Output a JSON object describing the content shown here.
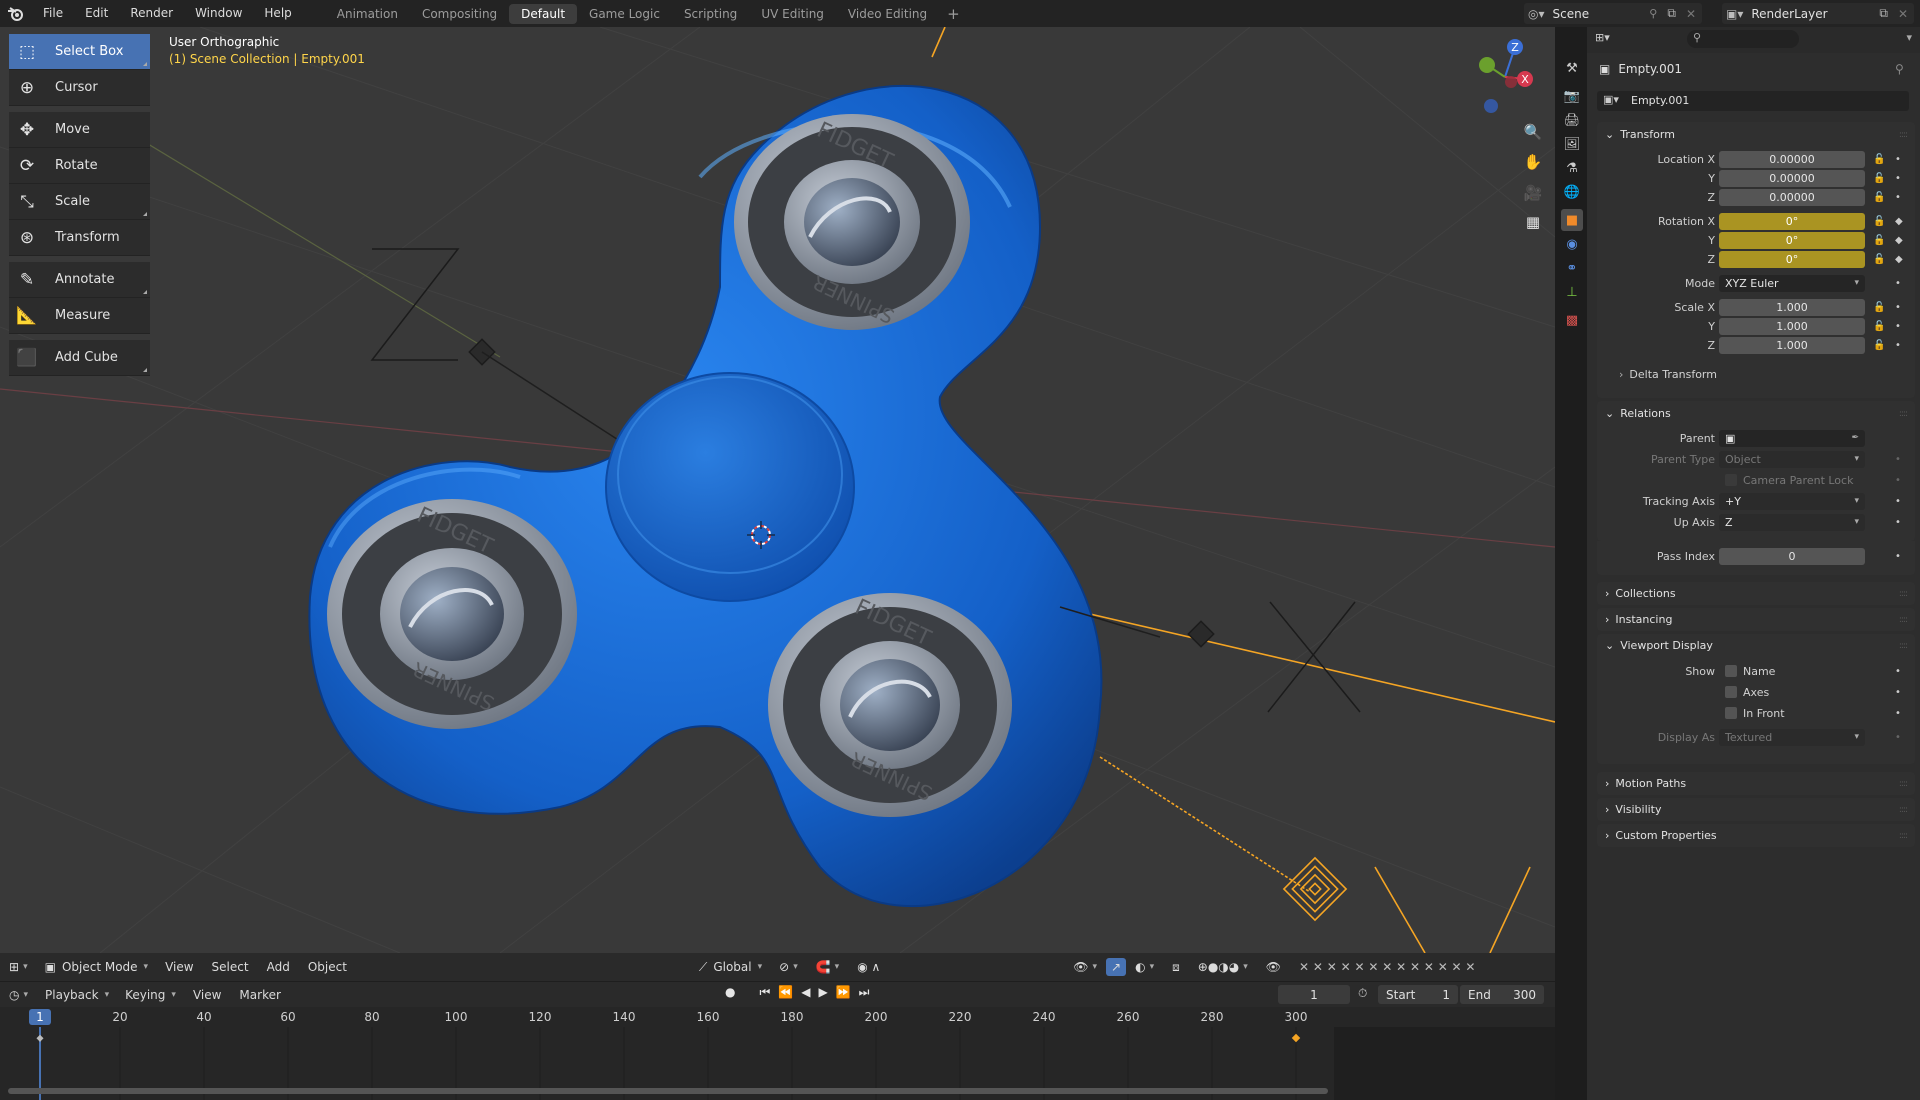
{
  "topbar": {
    "menus": [
      "File",
      "Edit",
      "Render",
      "Window",
      "Help"
    ],
    "workspaces": [
      "Animation",
      "Compositing",
      "Default",
      "Game Logic",
      "Scripting",
      "UV Editing",
      "Video Editing"
    ],
    "active_workspace": "Default",
    "scene": "Scene",
    "view_layer": "RenderLayer"
  },
  "toolbar": {
    "tools": [
      {
        "label": "Select Box",
        "icon": "select-box-icon",
        "active": true
      },
      {
        "label": "Cursor",
        "icon": "cursor-icon"
      },
      {
        "label": "Move",
        "icon": "move-icon"
      },
      {
        "label": "Rotate",
        "icon": "rotate-icon"
      },
      {
        "label": "Scale",
        "icon": "scale-icon"
      },
      {
        "label": "Transform",
        "icon": "transform-icon"
      },
      {
        "label": "Annotate",
        "icon": "annotate-icon"
      },
      {
        "label": "Measure",
        "icon": "measure-icon"
      },
      {
        "label": "Add Cube",
        "icon": "add-cube-icon"
      }
    ]
  },
  "viewport": {
    "view_name": "User Orthographic",
    "collection_path": "(1) Scene Collection | Empty.001",
    "gizmo_labels": [
      "Z",
      "X",
      "Y"
    ],
    "logo_top": "FIDGET",
    "logo_bottom": "SPINNER"
  },
  "vp_header": {
    "mode": "Object Mode",
    "menus": [
      "View",
      "Select",
      "Add",
      "Object"
    ],
    "orientation": "Global"
  },
  "timeline": {
    "menus": [
      "Playback",
      "Keying",
      "View",
      "Marker"
    ],
    "current_frame": "1",
    "start_label": "Start",
    "start": "1",
    "end_label": "End",
    "end": "300",
    "cursor_label": "1",
    "ticks": [
      "20",
      "40",
      "60",
      "80",
      "100",
      "120",
      "140",
      "160",
      "180",
      "200",
      "220",
      "240",
      "260",
      "280",
      "300"
    ]
  },
  "properties": {
    "object_name": "Empty.001",
    "data_name": "Empty.001",
    "transform": {
      "title": "Transform",
      "location_label": "Location X",
      "y_label": "Y",
      "z_label": "Z",
      "location": [
        "0.00000",
        "0.00000",
        "0.00000"
      ],
      "rotation_label": "Rotation X",
      "rotation": [
        "0°",
        "0°",
        "0°"
      ],
      "mode_label": "Mode",
      "mode": "XYZ Euler",
      "scale_label": "Scale X",
      "scale": [
        "1.000",
        "1.000",
        "1.000"
      ],
      "delta": "Delta Transform"
    },
    "relations": {
      "title": "Relations",
      "parent_label": "Parent",
      "parent_type_label": "Parent Type",
      "parent_type": "Object",
      "camera_parent_lock": "Camera Parent Lock",
      "tracking_axis_label": "Tracking Axis",
      "tracking_axis": "+Y",
      "up_axis_label": "Up Axis",
      "up_axis": "Z",
      "pass_index_label": "Pass Index",
      "pass_index": "0"
    },
    "collections": "Collections",
    "instancing": "Instancing",
    "viewport_display": {
      "title": "Viewport Display",
      "show_label": "Show",
      "name": "Name",
      "axes": "Axes",
      "in_front": "In Front",
      "display_as_label": "Display As",
      "display_as": "Textured"
    },
    "motion_paths": "Motion Paths",
    "visibility": "Visibility",
    "custom_properties": "Custom Properties"
  },
  "colors": {
    "accent": "#4772b3",
    "keyframe": "#aa9422",
    "spinner": "#1f6fd6",
    "selection": "#f5a524"
  }
}
